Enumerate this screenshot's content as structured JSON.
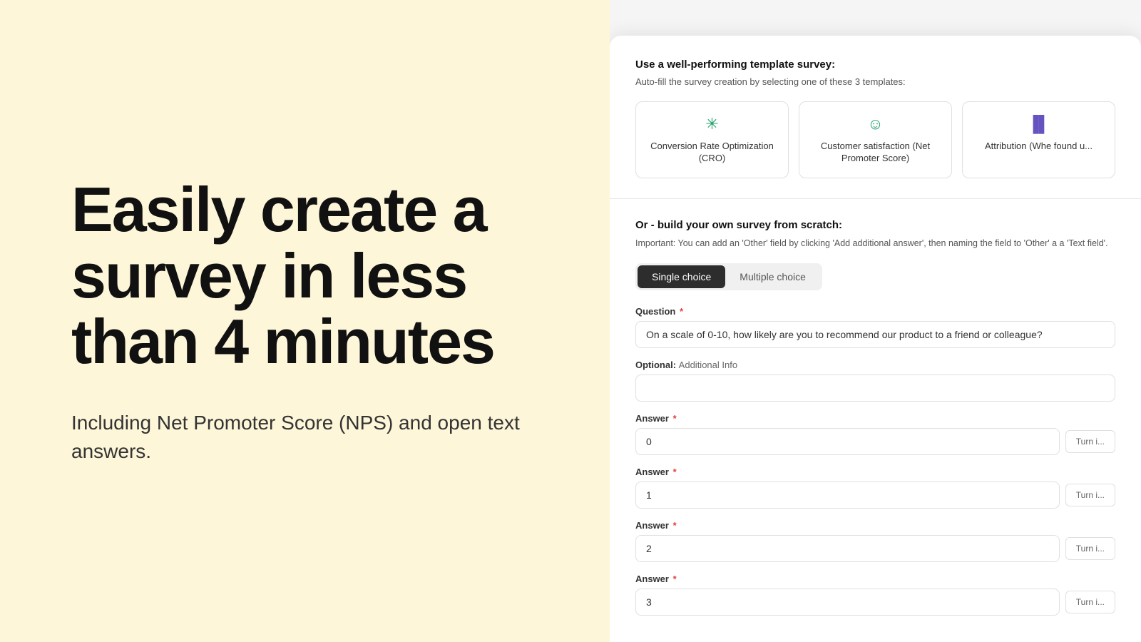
{
  "left": {
    "title": "Easily create a survey in less than 4 minutes",
    "subtitle": "Including Net Promoter Score (NPS) and open text answers."
  },
  "right": {
    "template_section": {
      "title": "Use a well-performing template survey:",
      "subtitle": "Auto-fill the survey creation by selecting one of these 3 templates:",
      "templates": [
        {
          "icon": "✳️",
          "label": "Conversion Rate Optimization (CRO)"
        },
        {
          "icon": "😊",
          "label": "Customer satisfaction (Net Promoter Score)"
        },
        {
          "icon": "📊",
          "label": "Attribution (Whe found u..."
        }
      ]
    },
    "scratch_section": {
      "title": "Or - build your own survey from scratch:",
      "note": "Important: You can add an 'Other' field by clicking 'Add additional answer', then naming the field to 'Other' a a 'Text field'.",
      "toggle": {
        "options": [
          "Single choice",
          "Multiple choice"
        ],
        "active": "Single choice"
      },
      "question_label": "Question",
      "question_required": true,
      "question_value": "On a scale of 0-10, how likely are you to recommend our product to a friend or colleague?",
      "optional_label": "Optional:",
      "optional_text": "Additional Info",
      "optional_value": "",
      "answers": [
        {
          "label": "Answer",
          "required": true,
          "value": "0",
          "turn_in_label": "Turn in"
        },
        {
          "label": "Answer",
          "required": true,
          "value": "1",
          "turn_in_label": "Turn in"
        },
        {
          "label": "Answer",
          "required": true,
          "value": "2",
          "turn_in_label": "Turn in"
        },
        {
          "label": "Answer",
          "required": true,
          "value": "3",
          "turn_in_label": "Turn in"
        }
      ]
    }
  }
}
